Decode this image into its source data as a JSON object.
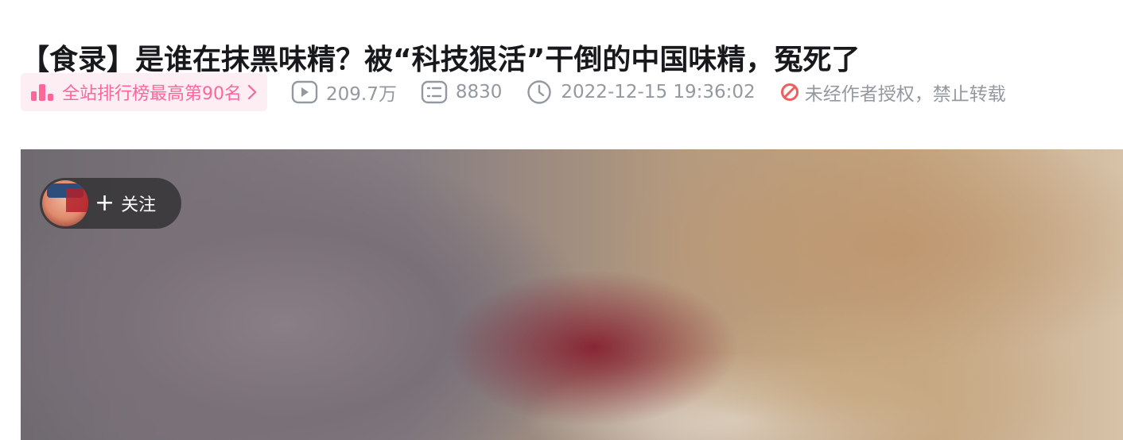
{
  "video": {
    "title": "【食录】是谁在抹黑味精？被“科技狠活”干倒的中国味精，冤死了"
  },
  "meta": {
    "rank_badge": "全站排行榜最高第90名",
    "views": "209.7万",
    "danmaku": "8830",
    "pubdate": "2022-12-15 19:36:02",
    "copyright": "未经作者授权，禁止转载"
  },
  "player": {
    "follow_label": "关注",
    "follow_plus": "+"
  },
  "colors": {
    "accent_pink": "#ff6699",
    "badge_bg": "#fdeef3",
    "meta_gray": "#9499a0",
    "forbid_red": "#f25d5d",
    "title_text": "#18191c"
  },
  "icons": [
    "rank-bars-icon",
    "chevron-right-icon",
    "play-count-icon",
    "danmaku-icon",
    "clock-icon",
    "forbid-icon",
    "plus-icon"
  ]
}
